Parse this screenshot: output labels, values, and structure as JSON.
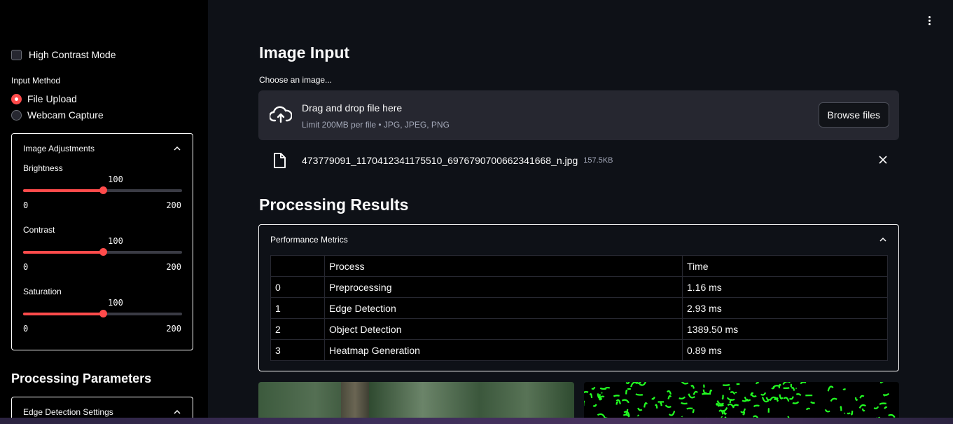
{
  "sidebar": {
    "high_contrast_label": "High Contrast Mode",
    "input_method_label": "Input Method",
    "input_methods": [
      {
        "label": "File Upload",
        "selected": true
      },
      {
        "label": "Webcam Capture",
        "selected": false
      }
    ],
    "image_adjustments": {
      "title": "Image Adjustments",
      "sliders": [
        {
          "label": "Brightness",
          "value": "100",
          "min": "0",
          "max": "200"
        },
        {
          "label": "Contrast",
          "value": "100",
          "min": "0",
          "max": "200"
        },
        {
          "label": "Saturation",
          "value": "100",
          "min": "0",
          "max": "200"
        }
      ]
    },
    "processing_parameters_title": "Processing Parameters",
    "edge_detection_title": "Edge Detection Settings"
  },
  "main": {
    "image_input_title": "Image Input",
    "uploader": {
      "label": "Choose an image...",
      "drag_text": "Drag and drop file here",
      "limit_text": "Limit 200MB per file • JPG, JPEG, PNG",
      "browse_label": "Browse files"
    },
    "file": {
      "name": "473779091_1170412341175510_6976790700662341668_n.jpg",
      "size": "157.5KB"
    },
    "processing_results_title": "Processing Results",
    "performance_metrics": {
      "title": "Performance Metrics",
      "columns": [
        "",
        "Process",
        "Time"
      ],
      "rows": [
        {
          "index": "0",
          "process": "Preprocessing",
          "time": "1.16 ms"
        },
        {
          "index": "1",
          "process": "Edge Detection",
          "time": "2.93 ms"
        },
        {
          "index": "2",
          "process": "Object Detection",
          "time": "1389.50 ms"
        },
        {
          "index": "3",
          "process": "Heatmap Generation",
          "time": "0.89 ms"
        }
      ]
    }
  },
  "colors": {
    "accent": "#ff4b4b",
    "background": "#0e1117",
    "sidebar": "#000000",
    "edge_overlay": "#22ff22"
  },
  "icons": [
    "menu-dots-icon",
    "cloud-upload-icon",
    "file-icon",
    "close-icon",
    "chevron-up-icon"
  ]
}
